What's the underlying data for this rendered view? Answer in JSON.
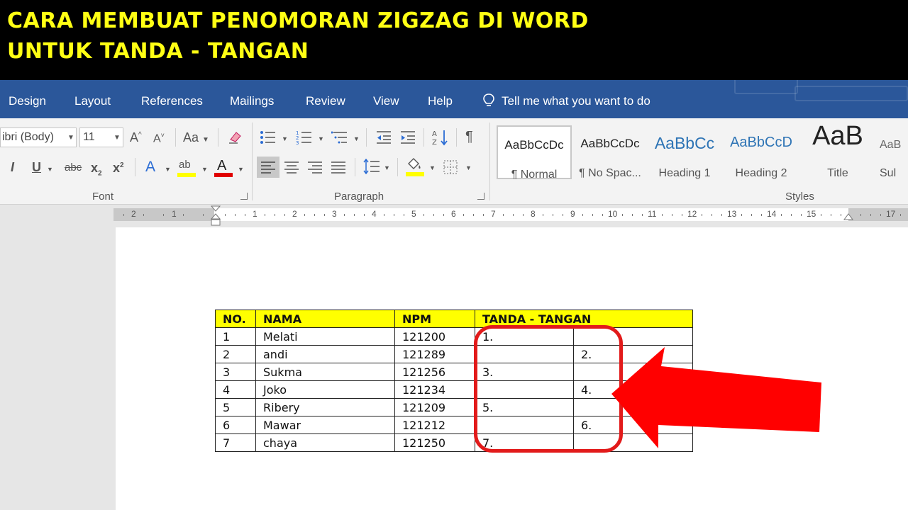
{
  "banner": {
    "line1": "CARA MEMBUAT PENOMORAN ZIGZAG DI WORD",
    "line2": "UNTUK TANDA - TANGAN"
  },
  "tabs": [
    {
      "label": "Design"
    },
    {
      "label": "Layout"
    },
    {
      "label": "References"
    },
    {
      "label": "Mailings"
    },
    {
      "label": "Review"
    },
    {
      "label": "View"
    },
    {
      "label": "Help"
    }
  ],
  "tell_me": {
    "icon": "lightbulb-icon",
    "text": "Tell me what you want to do"
  },
  "font": {
    "name": "ibri (Body)",
    "size": "11",
    "grow_label": "A",
    "shrink_label": "A",
    "case_label": "Aa",
    "italic_label": "I",
    "underline_label": "U",
    "strike_label": "abc",
    "sub_label": "x",
    "sub_mark": "2",
    "sup_label": "x",
    "sup_mark": "2",
    "effects_label": "A",
    "highlight_label": "ab",
    "font_color_label": "A",
    "group_label": "Font"
  },
  "paragraph": {
    "group_label": "Paragraph",
    "pilcrow": "¶"
  },
  "styles": {
    "group_label": "Styles",
    "items": [
      {
        "preview": "AaBbCcDc",
        "name": "¶ Normal"
      },
      {
        "preview": "AaBbCcDc",
        "name": "¶ No Spac..."
      },
      {
        "preview": "AaBbCc",
        "name": "Heading 1"
      },
      {
        "preview": "AaBbCcD",
        "name": "Heading 2"
      },
      {
        "preview": "AaB",
        "name": "Title"
      },
      {
        "preview": "AaB",
        "name": "Sul"
      }
    ]
  },
  "ruler": {
    "left_numbers": [
      "2",
      "1"
    ],
    "right_numbers": [
      "1",
      "2",
      "3",
      "4",
      "5",
      "6",
      "7",
      "8",
      "9",
      "10",
      "11",
      "12",
      "13",
      "14",
      "15"
    ],
    "end_number": "17"
  },
  "table": {
    "headers": [
      "NO.",
      "NAMA",
      "NPM",
      "TANDA - TANGAN"
    ],
    "rows": [
      [
        "1",
        "Melati",
        "121200",
        "1.",
        ""
      ],
      [
        "2",
        "andi",
        "121289",
        "",
        "2."
      ],
      [
        "3",
        "Sukma",
        "121256",
        "3.",
        ""
      ],
      [
        "4",
        "Joko",
        "121234",
        "",
        "4."
      ],
      [
        "5",
        "Ribery",
        "121209",
        "5.",
        ""
      ],
      [
        "6",
        "Mawar",
        "121212",
        "",
        "6."
      ],
      [
        "7",
        "chaya",
        "121250",
        "7.",
        ""
      ]
    ]
  },
  "colors": {
    "banner_text": "#ffff14",
    "tab_bar": "#2b579a",
    "header_fill": "#ffff00",
    "annotation": "#e21a1a"
  }
}
